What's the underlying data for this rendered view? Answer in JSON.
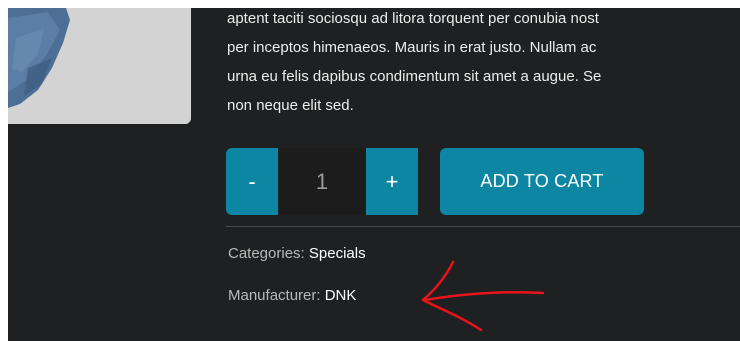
{
  "description": {
    "lines": [
      "aptent taciti sociosqu ad litora torquent per conubia nost",
      "per inceptos himenaeos. Mauris in erat justo. Nullam ac",
      "urna eu felis dapibus condimentum sit amet a augue. Se",
      "non neque elit sed."
    ]
  },
  "quantity": {
    "decrement_label": "-",
    "value": "1",
    "increment_label": "+"
  },
  "add_to_cart_label": "ADD TO CART",
  "meta": {
    "categories_label": "Categories:",
    "categories_value": "Specials",
    "manufacturer_label": "Manufacturer:",
    "manufacturer_value": "DNK"
  },
  "colors": {
    "accent": "#0d86a3",
    "background": "#1f2021",
    "annotation": "#e8141a"
  }
}
